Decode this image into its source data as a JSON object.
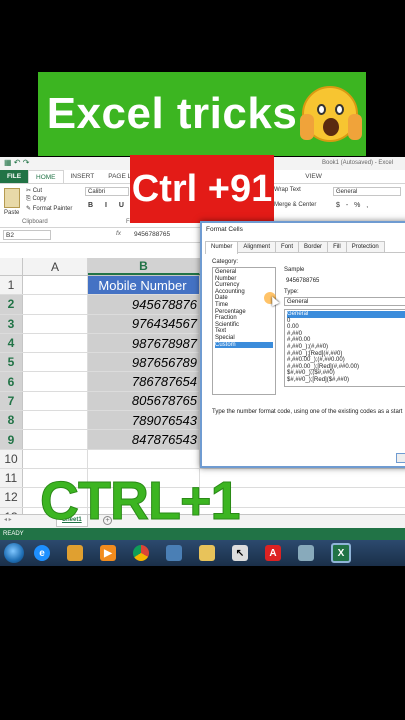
{
  "banner": {
    "title": "Excel tricks",
    "emoji": "screaming-face-emoji"
  },
  "overlay": {
    "ctrl_badge": "Ctrl +91",
    "ctrl_big": "CTRL+1"
  },
  "excel": {
    "document_title": "Book1 (Autosaved) - Excel",
    "tabs": {
      "file": "FILE",
      "home": "HOME",
      "insert": "INSERT",
      "page_layout": "PAGE L",
      "view": "VIEW"
    },
    "ribbon": {
      "paste": "Paste",
      "cut": "Cut",
      "copy": "Copy",
      "format_painter": "Format Painter",
      "clipboard_group": "Clipboard",
      "font_group": "Font",
      "font_name": "Calibri",
      "wrap_text": "Wrap Text",
      "merge_center": "Merge & Center",
      "number_format": "General",
      "number_icons": "$ - % ,"
    },
    "name_box": "B2",
    "formula_fx": "fx",
    "formula_value": "9456788765",
    "columns": [
      "A",
      "B"
    ],
    "column_b_header": "Mobile Number",
    "rows": [
      {
        "n": "1",
        "b": ""
      },
      {
        "n": "2",
        "b": "945678876"
      },
      {
        "n": "3",
        "b": "976434567"
      },
      {
        "n": "4",
        "b": "987678987"
      },
      {
        "n": "5",
        "b": "987656789"
      },
      {
        "n": "6",
        "b": "786787654"
      },
      {
        "n": "7",
        "b": "805678765"
      },
      {
        "n": "8",
        "b": "789076543"
      },
      {
        "n": "9",
        "b": "847876543"
      },
      {
        "n": "10",
        "b": ""
      },
      {
        "n": "11",
        "b": ""
      },
      {
        "n": "12",
        "b": ""
      },
      {
        "n": "13",
        "b": ""
      }
    ],
    "sheet_tab": "Sheet1",
    "status": "READY"
  },
  "dialog": {
    "title": "Format Cells",
    "tabs": [
      "Number",
      "Alignment",
      "Font",
      "Border",
      "Fill",
      "Protection"
    ],
    "category_label": "Category:",
    "categories": [
      "General",
      "Number",
      "Currency",
      "Accounting",
      "Date",
      "Time",
      "Percentage",
      "Fraction",
      "Scientific",
      "Text",
      "Special",
      "Custom"
    ],
    "selected_category": "Custom",
    "sample_label": "Sample",
    "sample_value": "9456788765",
    "type_label": "Type:",
    "type_value": "General",
    "types": [
      "General",
      "0",
      "0.00",
      "#,##0",
      "#,##0.00",
      "#,##0_);(#,##0)",
      "#,##0_);[Red](#,##0)",
      "#,##0.00_);(#,##0.00)",
      "#,##0.00_);[Red](#,##0.00)",
      "$#,##0_);($#,##0)",
      "$#,##0_);[Red]($#,##0)"
    ],
    "description": "Type the number format code, using one of the existing codes as a start"
  },
  "taskbar": {
    "icons": [
      "start-orb-icon",
      "internet-explorer-icon",
      "explorer-icon",
      "media-player-icon",
      "chrome-icon",
      "network-icon",
      "folder-icon",
      "cursor-app-icon",
      "pdf-icon",
      "display-icon",
      "excel-icon"
    ]
  }
}
